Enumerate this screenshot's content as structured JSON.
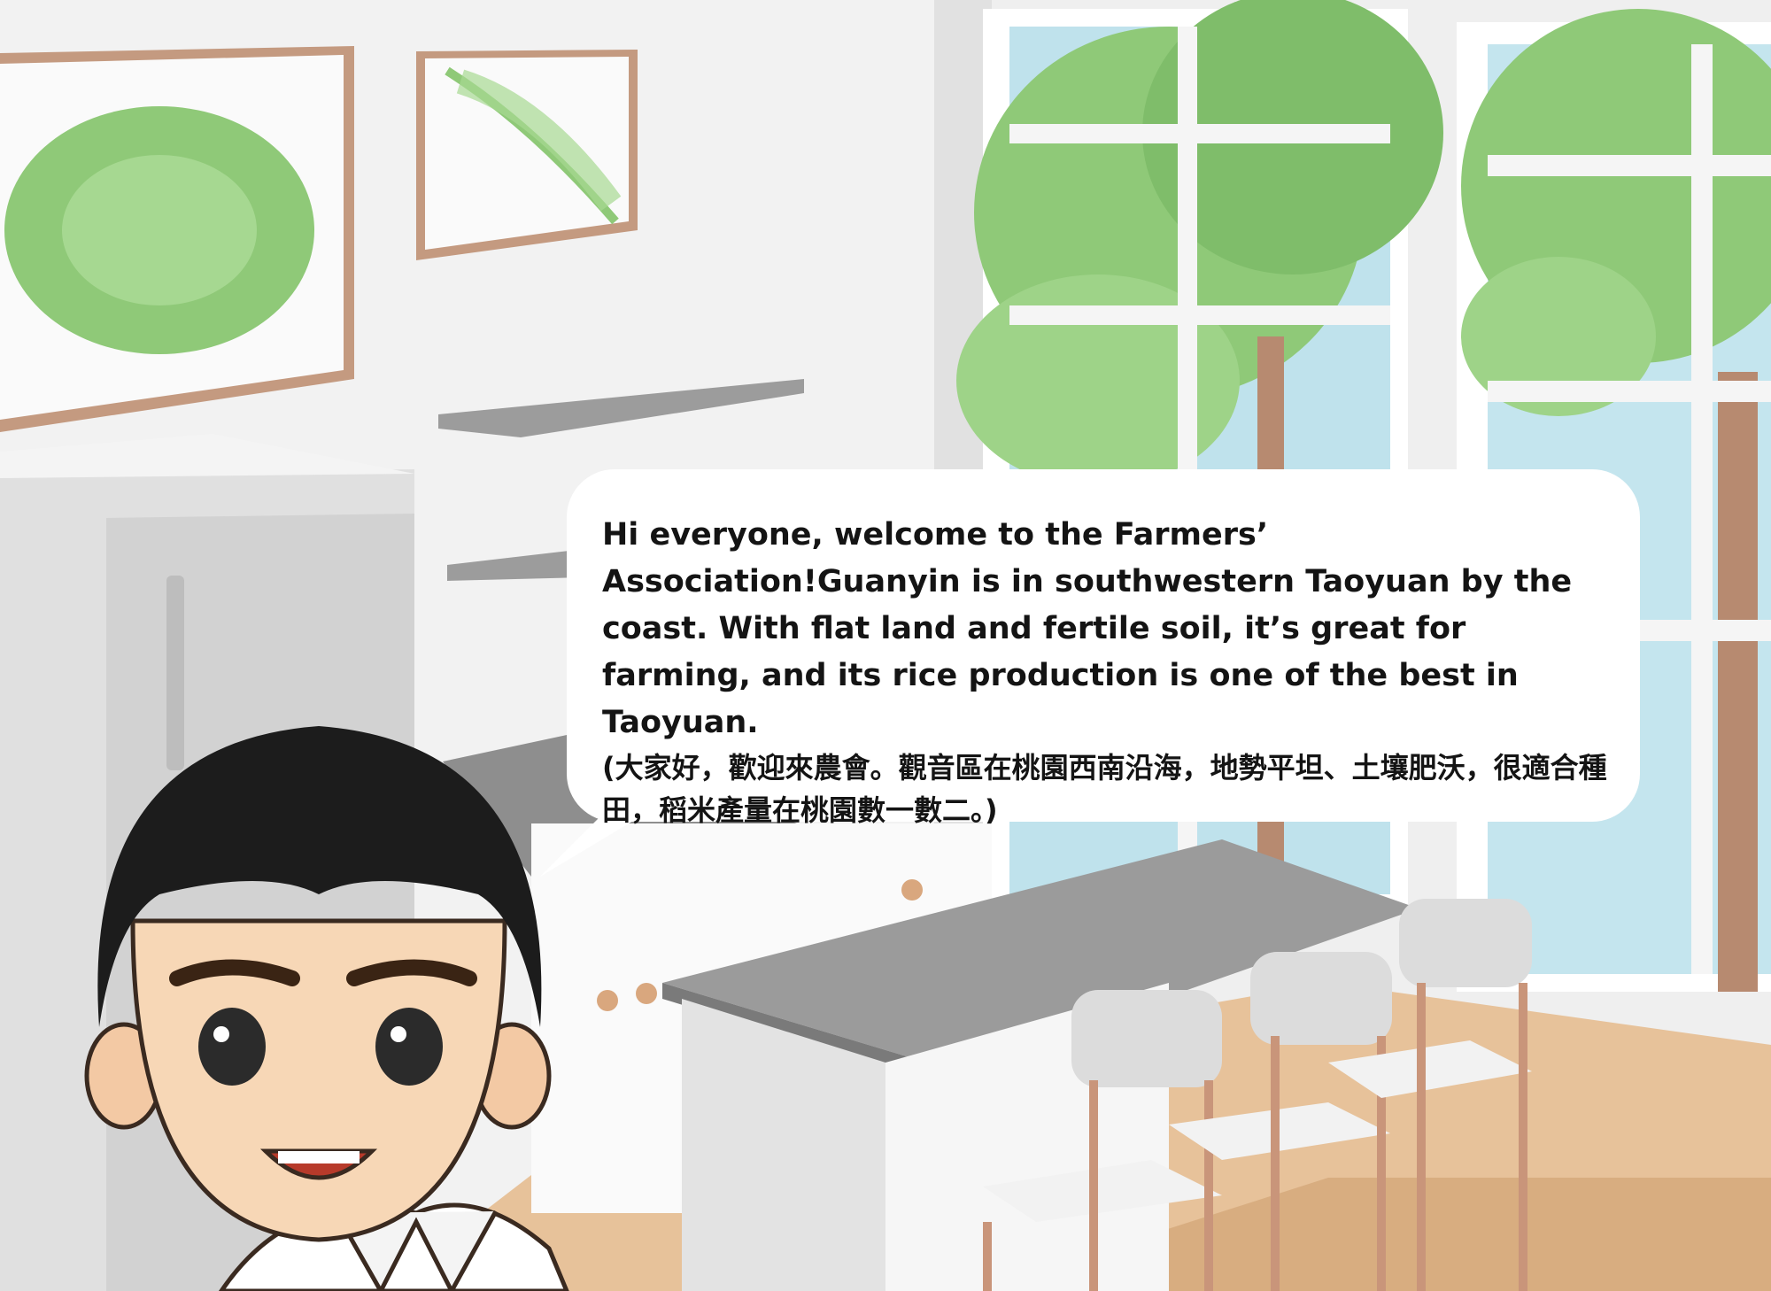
{
  "dialogue": {
    "english_text": "Hi everyone, welcome to the Farmers’ Association!Guanyin is in southwestern Taoyuan by the coast. With flat land and fertile soil, it’s great for farming, and its rice production is one of the best in Taoyuan.",
    "chinese_text": "(大家好，歡迎來農會。觀音區在桃園西南沿海，地勢平坦、土壤肥沃，很適合種田，稻米產量在桃園數一數二。)"
  },
  "scene": {
    "background_wall": "#efefef",
    "accent_leaf": "#8fc978",
    "frame_wood": "#c49a80",
    "counter_top": "#a6a6a6"
  }
}
